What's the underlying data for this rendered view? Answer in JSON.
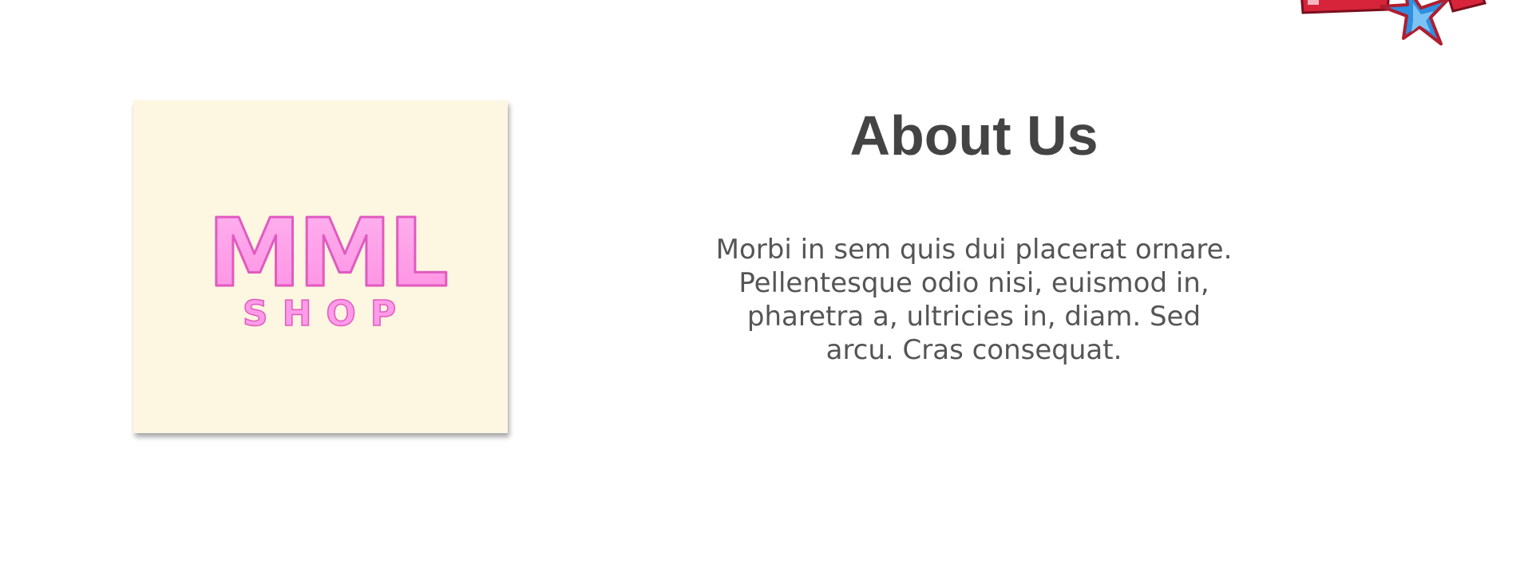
{
  "logo": {
    "wordmark": "MML",
    "subtext": "SHOP"
  },
  "about": {
    "title": "About Us",
    "text": "Morbi in sem quis dui placerat ornare. Pellentesque odio nisi, euismod in, pharetra a, ultricies in, diam. Sed arcu. Cras consequat."
  },
  "colors": {
    "logo_background": "#fdf6e0",
    "logo_pink": "#ff9be8",
    "logo_outline": "#e05bc0",
    "heading": "#444444",
    "body_text": "#555555"
  },
  "icons": {
    "corner_badge": "star-badge-icon"
  }
}
